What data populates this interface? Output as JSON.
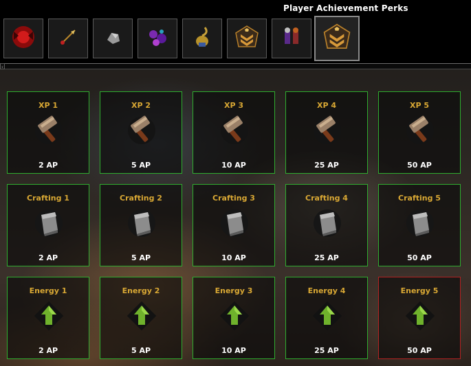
{
  "window": {
    "title": "Player Achievement Perks"
  },
  "tabs": [
    {
      "icon": "red-creature-icon"
    },
    {
      "icon": "arrow-icon"
    },
    {
      "icon": "ore-rock-icon"
    },
    {
      "icon": "purple-creatures-icon"
    },
    {
      "icon": "golden-scorpion-icon"
    },
    {
      "icon": "rank-chevron-icon"
    },
    {
      "icon": "armored-warriors-icon"
    },
    {
      "icon": "rank-chevron-icon",
      "selected": true
    }
  ],
  "rows": [
    {
      "name": "XP",
      "icon": "hammer-icon",
      "perks": [
        {
          "title": "XP 1",
          "cost": "2 AP",
          "state": "available"
        },
        {
          "title": "XP 2",
          "cost": "5 AP",
          "state": "available"
        },
        {
          "title": "XP 3",
          "cost": "10 AP",
          "state": "available"
        },
        {
          "title": "XP 4",
          "cost": "25 AP",
          "state": "available"
        },
        {
          "title": "XP 5",
          "cost": "50 AP",
          "state": "available"
        }
      ]
    },
    {
      "name": "Crafting",
      "icon": "metal-plate-icon",
      "perks": [
        {
          "title": "Crafting 1",
          "cost": "2 AP",
          "state": "available"
        },
        {
          "title": "Crafting 2",
          "cost": "5 AP",
          "state": "available"
        },
        {
          "title": "Crafting 3",
          "cost": "10 AP",
          "state": "available"
        },
        {
          "title": "Crafting 4",
          "cost": "25 AP",
          "state": "available"
        },
        {
          "title": "Crafting 5",
          "cost": "50 AP",
          "state": "available"
        }
      ]
    },
    {
      "name": "Energy",
      "icon": "green-up-arrow-icon",
      "perks": [
        {
          "title": "Energy 1",
          "cost": "2 AP",
          "state": "available"
        },
        {
          "title": "Energy 2",
          "cost": "5 AP",
          "state": "available"
        },
        {
          "title": "Energy 3",
          "cost": "10 AP",
          "state": "available"
        },
        {
          "title": "Energy 4",
          "cost": "25 AP",
          "state": "available"
        },
        {
          "title": "Energy 5",
          "cost": "50 AP",
          "state": "locked"
        }
      ]
    }
  ],
  "colors": {
    "border_available": "#2fae2f",
    "border_locked": "#b32222",
    "title_gold": "#d9a834",
    "cost_white": "#ffffff"
  }
}
